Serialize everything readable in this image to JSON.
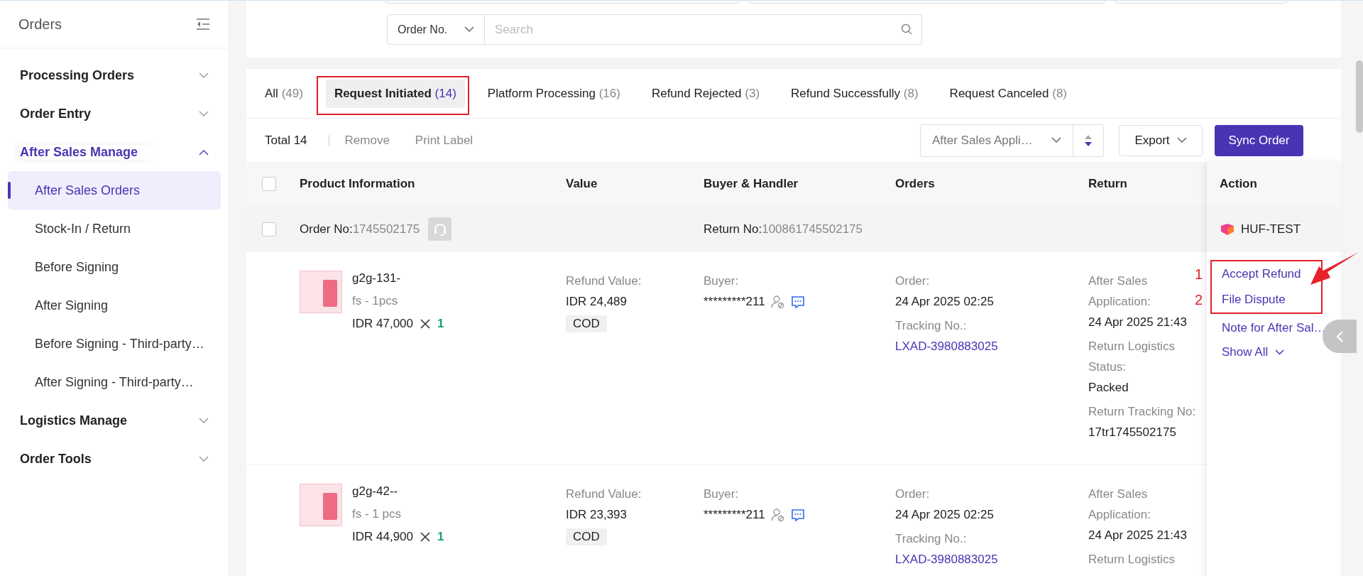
{
  "sidebar": {
    "title": "Orders",
    "groups": [
      {
        "label": "Processing Orders",
        "expanded": false
      },
      {
        "label": "Order Entry",
        "expanded": false
      },
      {
        "label": "After Sales Manage",
        "expanded": true,
        "children": [
          {
            "label": "After Sales Orders",
            "selected": true
          },
          {
            "label": "Stock-In / Return",
            "selected": false
          },
          {
            "label": "Before Signing",
            "selected": false
          },
          {
            "label": "After Signing",
            "selected": false
          },
          {
            "label": "Before Signing - Third-party…",
            "selected": false
          },
          {
            "label": "After Signing - Third-party…",
            "selected": false
          }
        ]
      },
      {
        "label": "Logistics Manage",
        "expanded": false
      },
      {
        "label": "Order Tools",
        "expanded": false
      }
    ]
  },
  "filters": {
    "field_type": "Order No.",
    "search": {
      "placeholder": "Search"
    }
  },
  "tabs": [
    {
      "label": "All",
      "count": "(49)",
      "selected": false,
      "annotated": false
    },
    {
      "label": "Request Initiated",
      "count": "(14)",
      "selected": true,
      "annotated": true
    },
    {
      "label": "Platform Processing",
      "count": "(16)",
      "selected": false,
      "annotated": false
    },
    {
      "label": "Refund Rejected",
      "count": "(3)",
      "selected": false,
      "annotated": false
    },
    {
      "label": "Refund Successfully",
      "count": "(8)",
      "selected": false,
      "annotated": false
    },
    {
      "label": "Request Canceled",
      "count": "(8)",
      "selected": false,
      "annotated": false
    }
  ],
  "toolbar": {
    "total": "Total 14",
    "actions": [
      "Remove",
      "Print Label"
    ],
    "sort": "After Sales Appli…",
    "export": "Export",
    "sync": "Sync Order"
  },
  "table": {
    "columns": [
      "Product Information",
      "Value",
      "Buyer & Handler",
      "Orders",
      "Return",
      "Action"
    ],
    "header_checked": false,
    "order": {
      "checked": false,
      "order_label": "Order No:",
      "order_no": "1745502175",
      "return_label": "Return No:",
      "return_no": "100861745502175",
      "store": "HUF-TEST",
      "actions": [
        {
          "label": "Accept Refund",
          "kind": "link",
          "marker": "1"
        },
        {
          "label": "File Dispute",
          "kind": "link",
          "marker": "2"
        },
        {
          "label": "Note for After Sal…",
          "kind": "link"
        },
        {
          "label": "Show All",
          "kind": "expand"
        }
      ],
      "items": [
        {
          "name": "g2g-131-",
          "spec": "fs - 1pcs",
          "price": "IDR 47,000",
          "qty": "1",
          "value_label": "Refund Value:",
          "value": "IDR 24,489",
          "payment": "COD",
          "buyer_label": "Buyer:",
          "buyer": "*********211",
          "orders": [
            {
              "label": "Order:",
              "value": "24 Apr 2025 02:25"
            },
            {
              "label": "Tracking No.:",
              "value": "LXAD-3980883025",
              "kind": "link"
            }
          ],
          "return": [
            {
              "label": "After Sales Application:",
              "value": "24 Apr 2025 21:43"
            },
            {
              "label": "Return Logistics Status:",
              "value": "Packed"
            },
            {
              "label": "Return Tracking No:",
              "value": "17tr1745502175"
            }
          ]
        },
        {
          "name": "g2g-42--",
          "spec": "fs - 1 pcs",
          "price": "IDR 44,900",
          "qty": "1",
          "value_label": "Refund Value:",
          "value": "IDR 23,393",
          "payment": "COD",
          "buyer_label": "Buyer:",
          "buyer": "*********211",
          "orders": [
            {
              "label": "Order:",
              "value": "24 Apr 2025 02:25"
            },
            {
              "label": "Tracking No.:",
              "value": "LXAD-3980883025",
              "kind": "link"
            }
          ],
          "return": [
            {
              "label": "After Sales Application:",
              "value": "24 Apr 2025 21:43"
            },
            {
              "label": "Return Logistics"
            }
          ]
        }
      ]
    }
  }
}
